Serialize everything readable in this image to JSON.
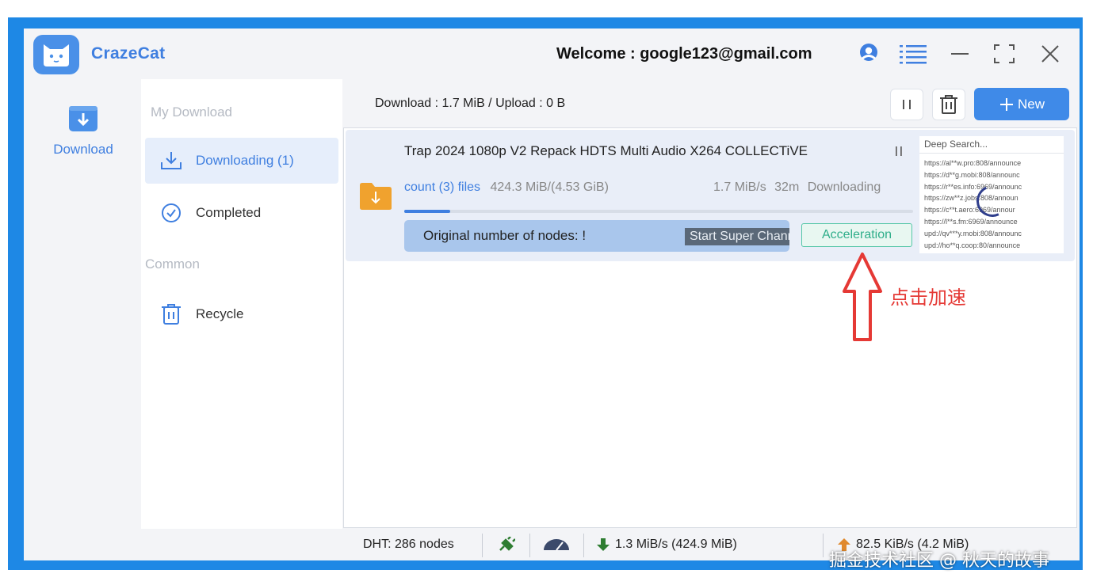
{
  "app": {
    "title": "CrazeCat",
    "welcome": "Welcome : google123@gmail.com"
  },
  "rail": {
    "download_label": "Download"
  },
  "sidebar": {
    "section_my": "My Download",
    "items": [
      {
        "label": "Downloading (1)",
        "icon": "download-tray-icon",
        "active": true
      },
      {
        "label": "Completed",
        "icon": "check-circle-icon",
        "active": false
      }
    ],
    "section_common": "Common",
    "recycle_label": "Recycle"
  },
  "toolbar": {
    "stats": "Download : 1.7 MiB / Upload : 0 B",
    "new_label": "New"
  },
  "task": {
    "name": "Trap 2024 1080p V2 Repack HDTS Multi Audio X264 COLLECTiVE",
    "count_label": "count (3) files",
    "size": "424.3 MiB/(4.53 GiB)",
    "speed": "1.7 MiB/s",
    "eta": "32m",
    "state": "Downloading",
    "progress": 0.09,
    "nodes_label": "Original number of nodes: !",
    "super_channel_label": "Start Super Channe",
    "acceleration_label": "Acceleration"
  },
  "deep_search": {
    "placeholder": "Deep Search...",
    "trackers": [
      "https://al**w.pro:808/announce",
      "https://d**g.mobi:808/announc",
      "https://r**es.info:6969/announc",
      "https://zw**z.jobs:808/announ",
      "https://c**t.aero:6969/annour",
      "https://l**s.fm:6969/announce",
      "upd://qv***y.mobi:808/announc",
      "upd://ho**q.coop:80/announce"
    ]
  },
  "statusbar": {
    "dht": "DHT: 286 nodes",
    "down": "1.3 MiB/s (424.9 MiB)",
    "up": "82.5 KiB/s (4.2 MiB)"
  },
  "annotation": {
    "text": "点击加速"
  },
  "watermark": "掘金技术社区 @ 秋天的故事",
  "colors": {
    "accent": "#3f7fe0",
    "frame": "#1e88e5",
    "accel": "#2fae8a",
    "annotation": "#e53935"
  }
}
